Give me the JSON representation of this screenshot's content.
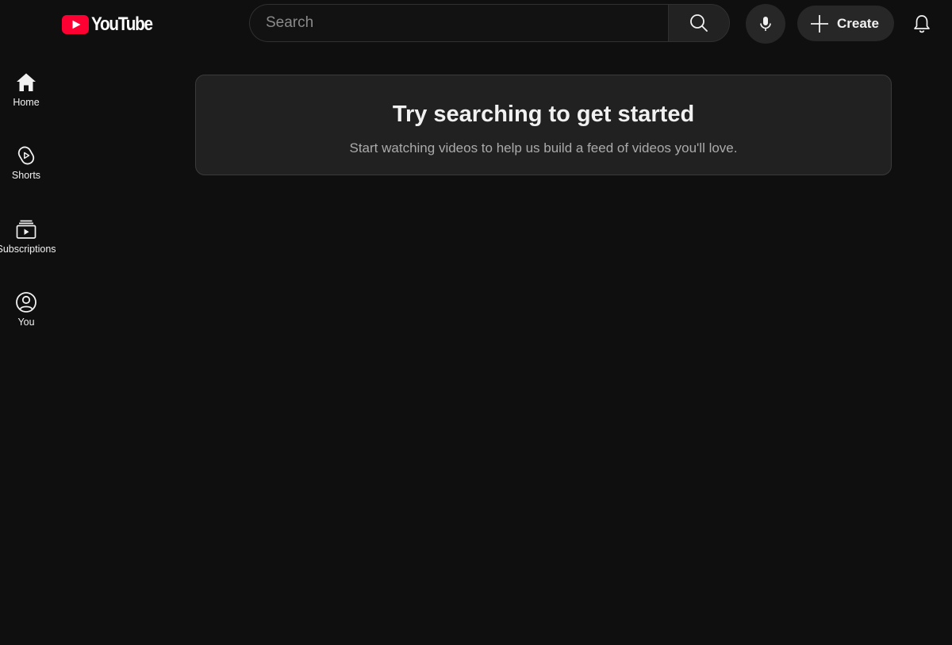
{
  "brand": {
    "name": "YouTube",
    "logo_color": "#ff0033"
  },
  "header": {
    "search_placeholder": "Search",
    "create_label": "Create",
    "icons": [
      "search-icon",
      "microphone-icon",
      "plus-icon",
      "bell-icon"
    ]
  },
  "sidebar": {
    "items": [
      {
        "label": "Home",
        "icon": "home-icon"
      },
      {
        "label": "Shorts",
        "icon": "shorts-icon"
      },
      {
        "label": "Subscriptions",
        "icon": "subscriptions-icon"
      },
      {
        "label": "You",
        "icon": "user-circle-icon"
      }
    ]
  },
  "main": {
    "title": "Try searching to get started",
    "subtitle": "Start watching videos to help us build a feed of videos you'll love."
  },
  "colors": {
    "background": "#0f0f0f",
    "card": "#212121",
    "button": "#272727",
    "text": "#f1f1f1",
    "muted_text": "#aaaaaa"
  }
}
